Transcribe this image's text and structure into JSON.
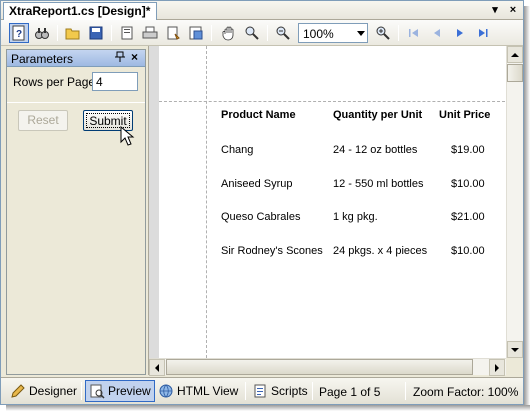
{
  "tab": {
    "title": "XtraReport1.cs [Design]*",
    "pin_glyph": "▾",
    "close_glyph": "×"
  },
  "toolbar": {
    "zoom_value": "100%",
    "icons": [
      "help-icon",
      "find-icon",
      "open-icon",
      "save-icon",
      "page-setup-icon",
      "print-icon",
      "quick-print-icon",
      "export-icon",
      "hand-tool-icon",
      "magnifier-icon",
      "zoom-out-icon",
      "zoom-in-icon",
      "first-page-icon",
      "previous-page-icon",
      "next-page-icon",
      "last-page-icon"
    ]
  },
  "parameters": {
    "title": "Parameters",
    "pin_glyph": "ᚁ",
    "close_glyph": "×",
    "rows_label": "Rows per Page:",
    "rows_value": "4",
    "reset_label": "Reset",
    "submit_label": "Submit"
  },
  "report": {
    "headers": [
      "Product Name",
      "Quantity per Unit",
      "Unit Price"
    ],
    "rows": [
      [
        "Chang",
        "24 - 12 oz bottles",
        "$19.00"
      ],
      [
        "Aniseed Syrup",
        "12 - 550 ml bottles",
        "$10.00"
      ],
      [
        "Queso Cabrales",
        "1 kg pkg.",
        "$21.00"
      ],
      [
        "Sir Rodney's Scones",
        "24 pkgs. x 4 pieces",
        "$10.00"
      ]
    ]
  },
  "statusbar": {
    "tabs": [
      "Designer",
      "Preview",
      "HTML View",
      "Scripts"
    ],
    "page_info": "Page 1 of 5",
    "zoom_factor": "Zoom Factor: 100%"
  },
  "colors": {
    "accent": "#316ac5",
    "panel_header": "#9eb9e2"
  }
}
